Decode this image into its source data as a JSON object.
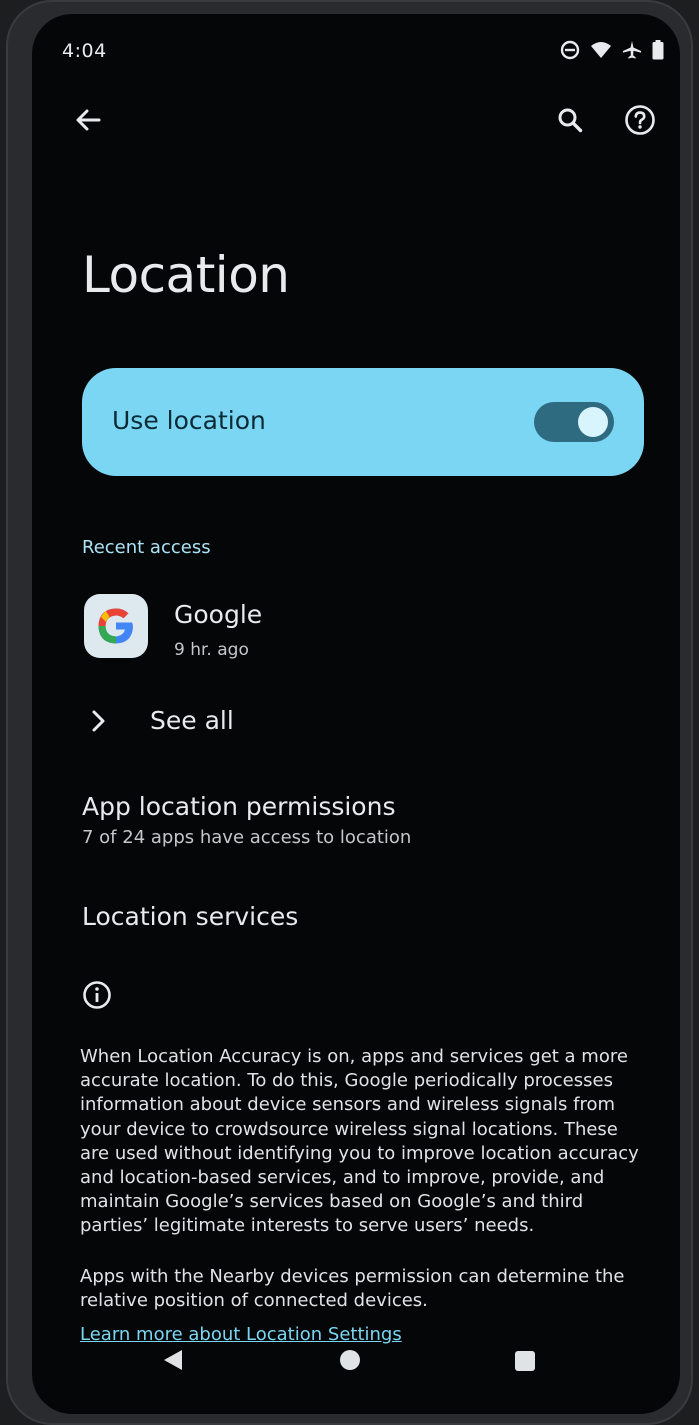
{
  "status_bar": {
    "time": "4:04",
    "icons": [
      "dnd-icon",
      "wifi-icon",
      "airplane-icon",
      "battery-icon"
    ]
  },
  "app_bar": {
    "back_icon": "arrow-back-icon",
    "search_icon": "search-icon",
    "help_icon": "help-icon"
  },
  "page": {
    "title": "Location"
  },
  "use_location": {
    "label": "Use location",
    "enabled": true,
    "card_color": "#7bd6f3"
  },
  "recent_access": {
    "section_label": "Recent access",
    "apps": [
      {
        "name": "Google",
        "time": "9 hr. ago",
        "icon": "google-g-icon"
      }
    ],
    "see_all_label": "See all"
  },
  "app_permissions": {
    "title": "App location permissions",
    "subtitle": "7 of 24 apps have access to location"
  },
  "location_services": {
    "title": "Location services"
  },
  "footer": {
    "info_icon": "info-icon",
    "paragraph1": "When Location Accuracy is on, apps and services get a more accurate location. To do this, Google periodically processes information about device sensors and wireless signals from your device to crowdsource wireless signal locations. These are used without identifying you to improve location accuracy and location-based services, and to improve, provide, and maintain Google’s services based on Google’s and third parties’ legitimate interests to serve users’ needs.",
    "paragraph2": "Apps with the Nearby devices permission can determine the relative position of connected devices.",
    "learn_more": "Learn more about Location Settings"
  },
  "nav_bar": {
    "back": "nav-back-icon",
    "home": "nav-home-icon",
    "recents": "nav-recents-icon"
  }
}
